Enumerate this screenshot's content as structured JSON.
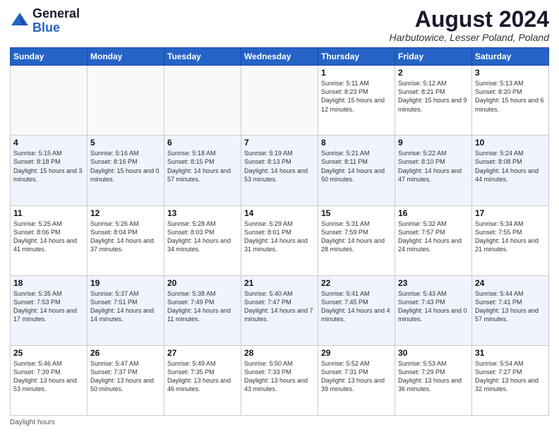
{
  "header": {
    "logo_general": "General",
    "logo_blue": "Blue",
    "month_title": "August 2024",
    "location": "Harbutowice, Lesser Poland, Poland"
  },
  "days_of_week": [
    "Sunday",
    "Monday",
    "Tuesday",
    "Wednesday",
    "Thursday",
    "Friday",
    "Saturday"
  ],
  "footer": {
    "daylight_label": "Daylight hours"
  },
  "weeks": [
    {
      "days": [
        {
          "num": "",
          "info": ""
        },
        {
          "num": "",
          "info": ""
        },
        {
          "num": "",
          "info": ""
        },
        {
          "num": "",
          "info": ""
        },
        {
          "num": "1",
          "info": "Sunrise: 5:11 AM\nSunset: 8:23 PM\nDaylight: 15 hours and 12 minutes."
        },
        {
          "num": "2",
          "info": "Sunrise: 5:12 AM\nSunset: 8:21 PM\nDaylight: 15 hours and 9 minutes."
        },
        {
          "num": "3",
          "info": "Sunrise: 5:13 AM\nSunset: 8:20 PM\nDaylight: 15 hours and 6 minutes."
        }
      ]
    },
    {
      "days": [
        {
          "num": "4",
          "info": "Sunrise: 5:15 AM\nSunset: 8:18 PM\nDaylight: 15 hours and 3 minutes."
        },
        {
          "num": "5",
          "info": "Sunrise: 5:16 AM\nSunset: 8:16 PM\nDaylight: 15 hours and 0 minutes."
        },
        {
          "num": "6",
          "info": "Sunrise: 5:18 AM\nSunset: 8:15 PM\nDaylight: 14 hours and 57 minutes."
        },
        {
          "num": "7",
          "info": "Sunrise: 5:19 AM\nSunset: 8:13 PM\nDaylight: 14 hours and 53 minutes."
        },
        {
          "num": "8",
          "info": "Sunrise: 5:21 AM\nSunset: 8:11 PM\nDaylight: 14 hours and 50 minutes."
        },
        {
          "num": "9",
          "info": "Sunrise: 5:22 AM\nSunset: 8:10 PM\nDaylight: 14 hours and 47 minutes."
        },
        {
          "num": "10",
          "info": "Sunrise: 5:24 AM\nSunset: 8:08 PM\nDaylight: 14 hours and 44 minutes."
        }
      ]
    },
    {
      "days": [
        {
          "num": "11",
          "info": "Sunrise: 5:25 AM\nSunset: 8:06 PM\nDaylight: 14 hours and 41 minutes."
        },
        {
          "num": "12",
          "info": "Sunrise: 5:26 AM\nSunset: 8:04 PM\nDaylight: 14 hours and 37 minutes."
        },
        {
          "num": "13",
          "info": "Sunrise: 5:28 AM\nSunset: 8:03 PM\nDaylight: 14 hours and 34 minutes."
        },
        {
          "num": "14",
          "info": "Sunrise: 5:29 AM\nSunset: 8:01 PM\nDaylight: 14 hours and 31 minutes."
        },
        {
          "num": "15",
          "info": "Sunrise: 5:31 AM\nSunset: 7:59 PM\nDaylight: 14 hours and 28 minutes."
        },
        {
          "num": "16",
          "info": "Sunrise: 5:32 AM\nSunset: 7:57 PM\nDaylight: 14 hours and 24 minutes."
        },
        {
          "num": "17",
          "info": "Sunrise: 5:34 AM\nSunset: 7:55 PM\nDaylight: 14 hours and 21 minutes."
        }
      ]
    },
    {
      "days": [
        {
          "num": "18",
          "info": "Sunrise: 5:35 AM\nSunset: 7:53 PM\nDaylight: 14 hours and 17 minutes."
        },
        {
          "num": "19",
          "info": "Sunrise: 5:37 AM\nSunset: 7:51 PM\nDaylight: 14 hours and 14 minutes."
        },
        {
          "num": "20",
          "info": "Sunrise: 5:38 AM\nSunset: 7:49 PM\nDaylight: 14 hours and 11 minutes."
        },
        {
          "num": "21",
          "info": "Sunrise: 5:40 AM\nSunset: 7:47 PM\nDaylight: 14 hours and 7 minutes."
        },
        {
          "num": "22",
          "info": "Sunrise: 5:41 AM\nSunset: 7:45 PM\nDaylight: 14 hours and 4 minutes."
        },
        {
          "num": "23",
          "info": "Sunrise: 5:43 AM\nSunset: 7:43 PM\nDaylight: 14 hours and 0 minutes."
        },
        {
          "num": "24",
          "info": "Sunrise: 5:44 AM\nSunset: 7:41 PM\nDaylight: 13 hours and 57 minutes."
        }
      ]
    },
    {
      "days": [
        {
          "num": "25",
          "info": "Sunrise: 5:46 AM\nSunset: 7:39 PM\nDaylight: 13 hours and 53 minutes."
        },
        {
          "num": "26",
          "info": "Sunrise: 5:47 AM\nSunset: 7:37 PM\nDaylight: 13 hours and 50 minutes."
        },
        {
          "num": "27",
          "info": "Sunrise: 5:49 AM\nSunset: 7:35 PM\nDaylight: 13 hours and 46 minutes."
        },
        {
          "num": "28",
          "info": "Sunrise: 5:50 AM\nSunset: 7:33 PM\nDaylight: 13 hours and 43 minutes."
        },
        {
          "num": "29",
          "info": "Sunrise: 5:52 AM\nSunset: 7:31 PM\nDaylight: 13 hours and 39 minutes."
        },
        {
          "num": "30",
          "info": "Sunrise: 5:53 AM\nSunset: 7:29 PM\nDaylight: 13 hours and 36 minutes."
        },
        {
          "num": "31",
          "info": "Sunrise: 5:54 AM\nSunset: 7:27 PM\nDaylight: 13 hours and 32 minutes."
        }
      ]
    }
  ]
}
